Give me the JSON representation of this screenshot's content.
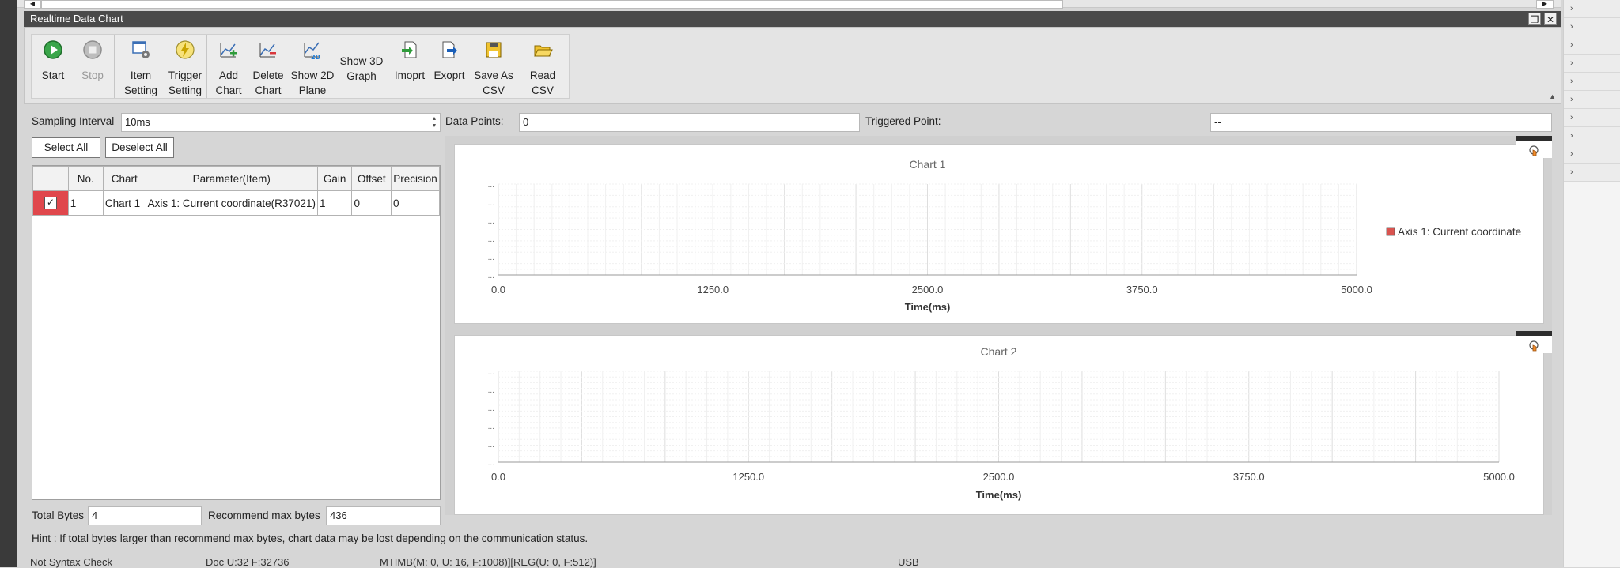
{
  "window": {
    "title": "Realtime Data Chart"
  },
  "toolbar": {
    "start": "Start",
    "stop": "Stop",
    "item_setting": "Item Setting",
    "trigger_setting": "Trigger Setting",
    "add_chart": "Add Chart",
    "delete_chart": "Delete Chart",
    "show_2d_plane": "Show 2D Plane",
    "show_3d_graph": "Show 3D Graph",
    "import": "Imoprt",
    "export": "Exoprt",
    "save_as_csv": "Save As CSV",
    "read_csv": "Read CSV"
  },
  "controls": {
    "sampling_label": "Sampling Interval",
    "sampling_value": "10ms",
    "data_points_label": "Data Points:",
    "data_points_value": "0",
    "triggered_point_label": "Triggered Point:",
    "triggered_point_value": "--",
    "select_all": "Select All",
    "deselect_all": "Deselect All"
  },
  "table": {
    "columns": [
      "",
      "No.",
      "Chart",
      "Parameter(Item)",
      "Gain",
      "Offset",
      "Precision"
    ],
    "rows": [
      {
        "checked": true,
        "no": "1",
        "chart": "Chart 1",
        "parameter": "Axis 1: Current coordinate(R37021)",
        "gain": "1",
        "offset": "0",
        "precision": "0"
      }
    ]
  },
  "footer": {
    "total_bytes_label": "Total Bytes",
    "total_bytes_value": "4",
    "recommend_label": "Recommend max bytes",
    "recommend_value": "436",
    "hint": "Hint : If total bytes larger than recommend max bytes, chart data may be lost depending on the communication status."
  },
  "status_bar": {
    "syntax": "Not Syntax Check",
    "doc": "Doc U:32 F:32736",
    "mtimb": "MTIMB(M: 0, U: 16, F:1008)][REG(U: 0, F:512)]",
    "conn": "USB"
  },
  "chart_data": [
    {
      "type": "line",
      "title": "Chart 1",
      "xlabel": "Time(ms)",
      "ylabel": "",
      "xlim": [
        0,
        5000
      ],
      "x_ticks": [
        "0.0",
        "1250.0",
        "2500.0",
        "3750.0",
        "5000.0"
      ],
      "y_tick_marks": "...",
      "grid": true,
      "legend_position": "right",
      "series": [
        {
          "name": "Axis 1: Current coordinate",
          "color": "#d9534f",
          "x": [],
          "y": []
        }
      ]
    },
    {
      "type": "line",
      "title": "Chart 2",
      "xlabel": "Time(ms)",
      "ylabel": "",
      "xlim": [
        0,
        5000
      ],
      "x_ticks": [
        "0.0",
        "1250.0",
        "2500.0",
        "3750.0",
        "5000.0"
      ],
      "y_tick_marks": "...",
      "grid": true,
      "series": []
    }
  ]
}
